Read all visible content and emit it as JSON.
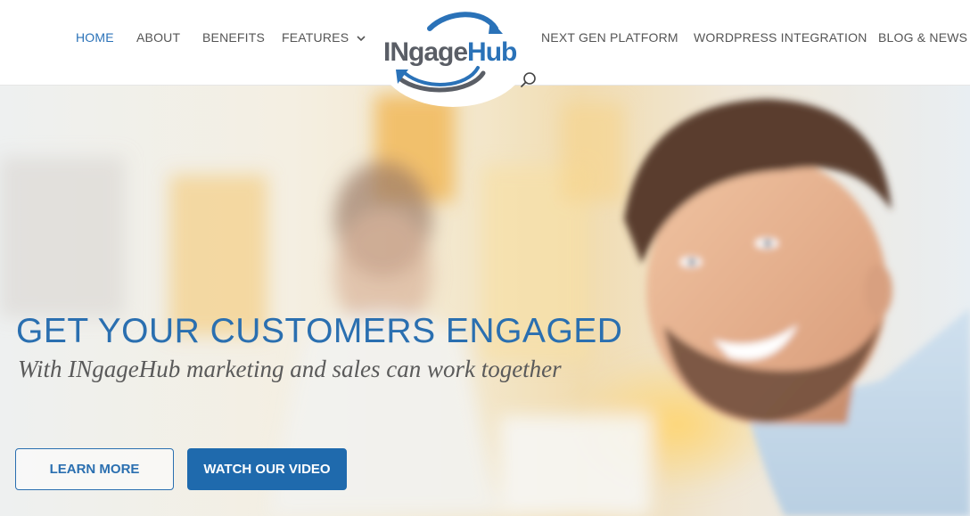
{
  "nav": {
    "home": "HOME",
    "about": "ABOUT",
    "benefits": "BENEFITS",
    "features": "FEATURES",
    "next_gen": "NEXT GEN PLATFORM",
    "wordpress": "WORDPRESS INTEGRATION",
    "blog": "BLOG & NEWS",
    "active": "HOME"
  },
  "logo": {
    "part1": "INgage",
    "part2": "Hub"
  },
  "hero": {
    "title": "GET YOUR CUSTOMERS ENGAGED",
    "subtitle": "With INgageHub marketing and sales can work together",
    "learn_more": "LEARN MORE",
    "watch_video": "WATCH OUR VIDEO"
  },
  "colors": {
    "accent": "#2a72b8",
    "nav_text": "#555555",
    "button_primary": "#1f6aad",
    "logo_gray": "#5a5e66"
  },
  "icons": {
    "search": "search-icon",
    "chevron": "chevron-down-icon",
    "logo_arrows": "logo-arrows-icon"
  }
}
